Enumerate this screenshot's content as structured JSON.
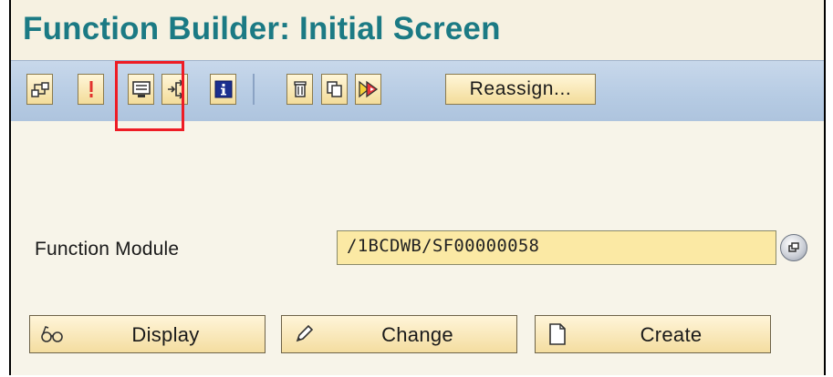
{
  "header": {
    "title": "Function Builder: Initial Screen"
  },
  "toolbar": {
    "buttons": [
      {
        "name": "other-object",
        "icon": "object-hierarchy-icon"
      },
      {
        "name": "check",
        "icon": "check-icon"
      },
      {
        "name": "test-execute",
        "icon": "test-screen-icon"
      },
      {
        "name": "where-used",
        "icon": "where-used-icon"
      },
      {
        "name": "info",
        "icon": "info-icon"
      },
      {
        "name": "delete",
        "icon": "trash-icon"
      },
      {
        "name": "copy",
        "icon": "copy-icon"
      },
      {
        "name": "rename",
        "icon": "rename-icon"
      }
    ],
    "reassign_label": "Reassign..."
  },
  "form": {
    "function_module_label": "Function Module",
    "function_module_value": "/1BCDWB/SF00000058"
  },
  "actions": {
    "display_label": "Display",
    "change_label": "Change",
    "create_label": "Create"
  },
  "colors": {
    "title": "#1b7a84",
    "toolbar_bg": "#b6cbe3",
    "button_bg": "#f3dc9a",
    "input_bg": "#fbe9a4",
    "highlight": "#ee1c25"
  }
}
